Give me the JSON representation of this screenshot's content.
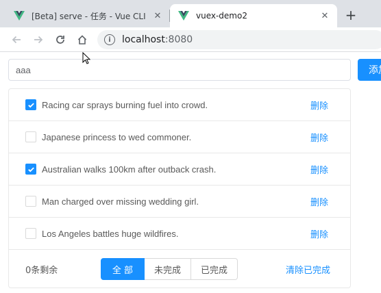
{
  "browser": {
    "tabs": [
      {
        "title": "[Beta] serve - 任务 - Vue CLI",
        "active": false
      },
      {
        "title": "vuex-demo2",
        "active": true
      }
    ],
    "close_glyph": "✕",
    "new_tab_glyph": "+",
    "address": {
      "host": "localhost",
      "port": ":8080"
    },
    "info_glyph": "i"
  },
  "app": {
    "input_value": "aaa",
    "add_label": "添加",
    "delete_label": "删除",
    "todos": [
      {
        "text": "Racing car sprays burning fuel into crowd.",
        "done": true
      },
      {
        "text": "Japanese princess to wed commoner.",
        "done": false
      },
      {
        "text": "Australian walks 100km after outback crash.",
        "done": true
      },
      {
        "text": "Man charged over missing wedding girl.",
        "done": false
      },
      {
        "text": "Los Angeles battles huge wildfires.",
        "done": false
      }
    ],
    "footer": {
      "remaining": "0条剩余",
      "filters": [
        "全 部",
        "未完成",
        "已完成"
      ],
      "active_filter": 0,
      "clear_label": "清除已完成"
    }
  },
  "colors": {
    "primary": "#1890ff",
    "vue_green": "#41b883",
    "vue_dark": "#35495e"
  }
}
